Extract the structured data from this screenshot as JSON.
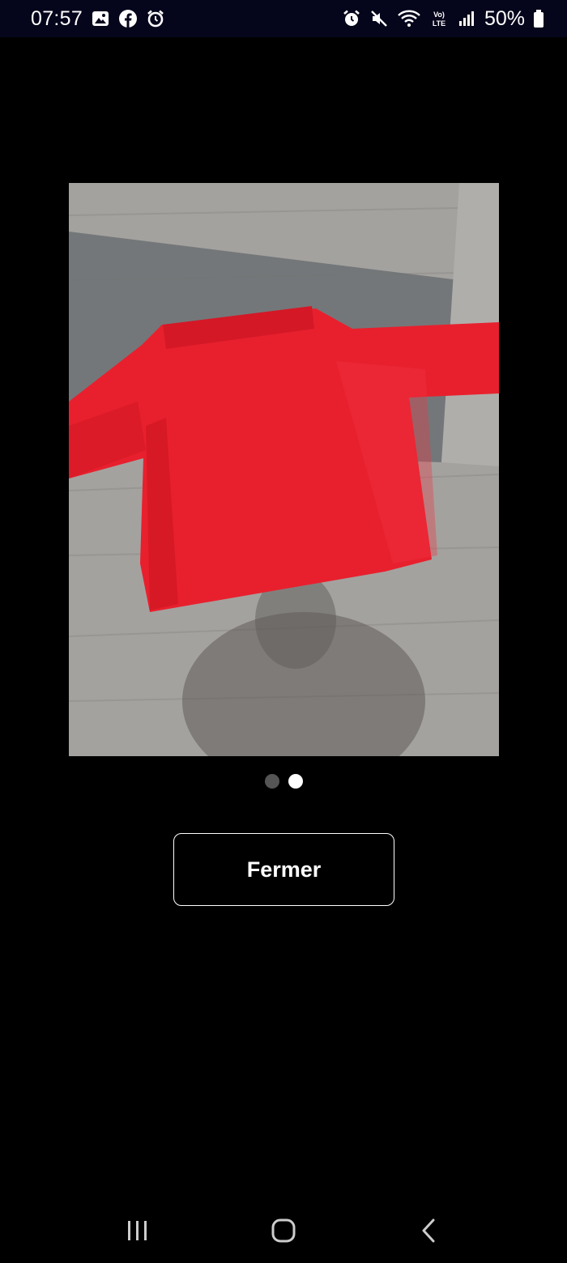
{
  "status_bar": {
    "time": "07:57",
    "battery_percent": "50%",
    "network_label": "Vo) LTE",
    "left_icons": [
      "gallery-icon",
      "facebook-icon",
      "alarm-icon"
    ],
    "right_icons": [
      "alarm-icon",
      "mute-icon",
      "wifi-icon",
      "volte-icon",
      "signal-icon",
      "battery-icon"
    ]
  },
  "viewer": {
    "page_count": 2,
    "current_page": 2,
    "close_label": "Fermer"
  },
  "nav_bar": {
    "buttons": [
      "recents-icon",
      "home-icon",
      "back-icon"
    ]
  },
  "colors": {
    "background": "#000000",
    "status_bar_bg": "#05051c",
    "shirt_red": "#e8202e",
    "dot_inactive": "#555555",
    "dot_active": "#ffffff"
  }
}
